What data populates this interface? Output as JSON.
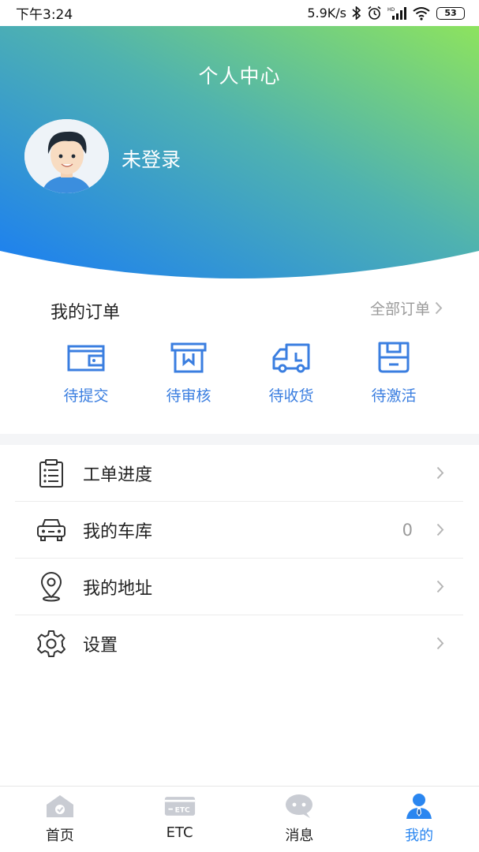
{
  "status_bar": {
    "time": "下午3:24",
    "network_speed": "5.9K/s",
    "battery": "53"
  },
  "header": {
    "title": "个人中心",
    "user_name": "未登录",
    "gradient_start": "#1a7df3",
    "gradient_end": "#8de35e"
  },
  "orders": {
    "title": "我的订单",
    "all_orders_label": "全部订单",
    "items": [
      {
        "label": "待提交",
        "icon": "wallet-icon"
      },
      {
        "label": "待审核",
        "icon": "review-box-icon"
      },
      {
        "label": "待收货",
        "icon": "delivery-truck-icon"
      },
      {
        "label": "待激活",
        "icon": "activate-icon"
      }
    ],
    "accent": "#3a7ee0"
  },
  "menu": {
    "items": [
      {
        "label": "工单进度",
        "icon": "clipboard-icon",
        "count": ""
      },
      {
        "label": "我的车库",
        "icon": "car-icon",
        "count": "0"
      },
      {
        "label": "我的地址",
        "icon": "location-pin-icon",
        "count": ""
      },
      {
        "label": "设置",
        "icon": "gear-icon",
        "count": ""
      }
    ]
  },
  "tabbar": {
    "items": [
      {
        "label": "首页",
        "icon": "home-icon",
        "active": false
      },
      {
        "label": "ETC",
        "icon": "etc-card-icon",
        "active": false
      },
      {
        "label": "消息",
        "icon": "message-icon",
        "active": false
      },
      {
        "label": "我的",
        "icon": "profile-icon",
        "active": true
      }
    ],
    "active_color": "#2a86f0",
    "inactive_icon_color": "#c9ccd3"
  }
}
